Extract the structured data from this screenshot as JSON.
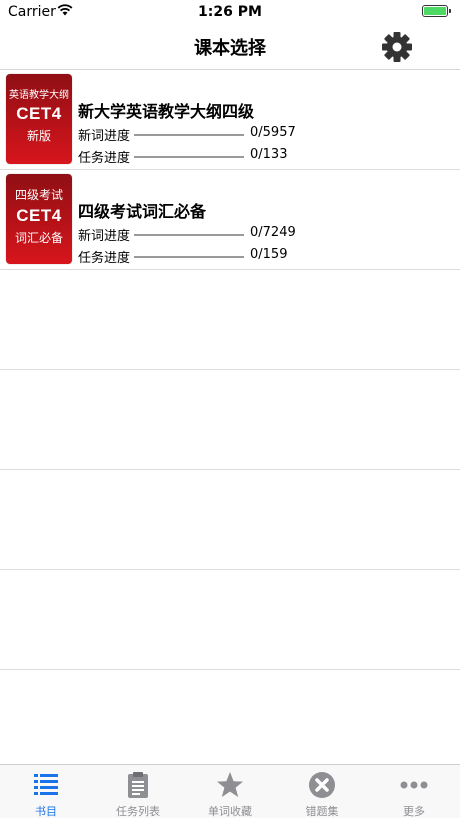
{
  "status_bar": {
    "carrier": "Carrier",
    "time": "1:26 PM"
  },
  "nav": {
    "title": "课本选择",
    "settings_icon": "gear-icon"
  },
  "books": [
    {
      "cover": {
        "line1": "英语教学大纲",
        "line2": "CET4",
        "line3": "新版"
      },
      "title": "新大学英语教学大纲四级",
      "new_words_label": "新词进度",
      "new_words_value": "0/5957",
      "tasks_label": "任务进度",
      "tasks_value": "0/133"
    },
    {
      "cover": {
        "line1": "四级考试",
        "line2": "CET4",
        "line3": "词汇必备"
      },
      "title": "四级考试词汇必备",
      "new_words_label": "新词进度",
      "new_words_value": "0/7249",
      "tasks_label": "任务进度",
      "tasks_value": "0/159"
    }
  ],
  "tabs": [
    {
      "label": "书目",
      "icon": "list-icon",
      "active": true
    },
    {
      "label": "任务列表",
      "icon": "clipboard-icon",
      "active": false
    },
    {
      "label": "单词收藏",
      "icon": "star-icon",
      "active": false
    },
    {
      "label": "错题集",
      "icon": "x-circle-icon",
      "active": false
    },
    {
      "label": "更多",
      "icon": "more-icon",
      "active": false
    }
  ],
  "colors": {
    "active_tab": "#1a73e8",
    "inactive_tab": "#8e8e93",
    "cover_red": "#d7151c",
    "battery": "#4cd964"
  }
}
